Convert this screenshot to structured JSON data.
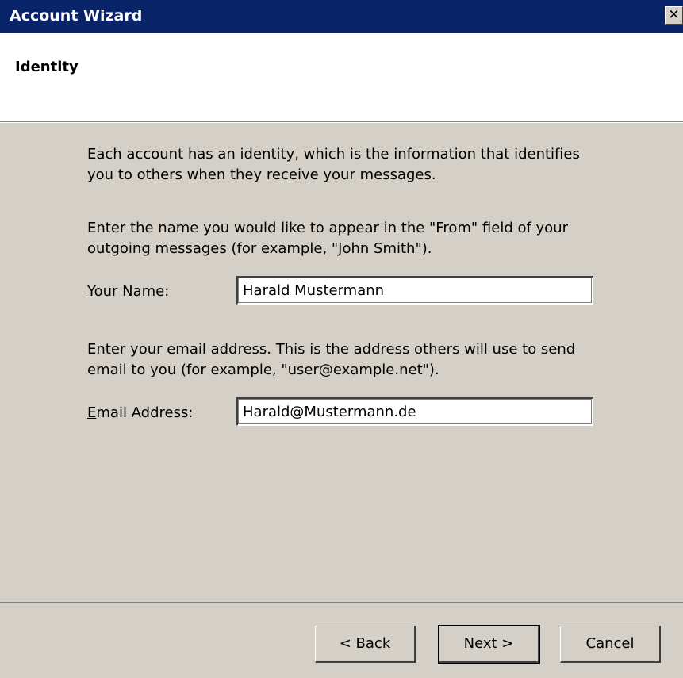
{
  "window": {
    "title": "Account Wizard",
    "close_label": "✕"
  },
  "header": {
    "page_title": "Identity"
  },
  "content": {
    "intro_text": "Each account has an identity, which is the information that identifies\nyou to others when they receive your messages.",
    "name_instructions": "Enter the name you would like to appear in the \"From\" field of your\noutgoing messages (for example, \"John Smith\").",
    "name_label_mnemonic": "Y",
    "name_label_rest": "our Name:",
    "name_value": "Harald Mustermann",
    "email_instructions": "Enter your email address. This is the address others will use to send\nemail to you (for example, \"user@example.net\").",
    "email_label_mnemonic": "E",
    "email_label_rest": "mail Address:",
    "email_value": "Harald@Mustermann.de"
  },
  "buttons": {
    "back": "< Back",
    "next": "Next >",
    "cancel": "Cancel"
  },
  "colors": {
    "titlebar": "#0a246a",
    "dialog_face": "#d4d0c8",
    "header_bg": "#ffffff"
  }
}
